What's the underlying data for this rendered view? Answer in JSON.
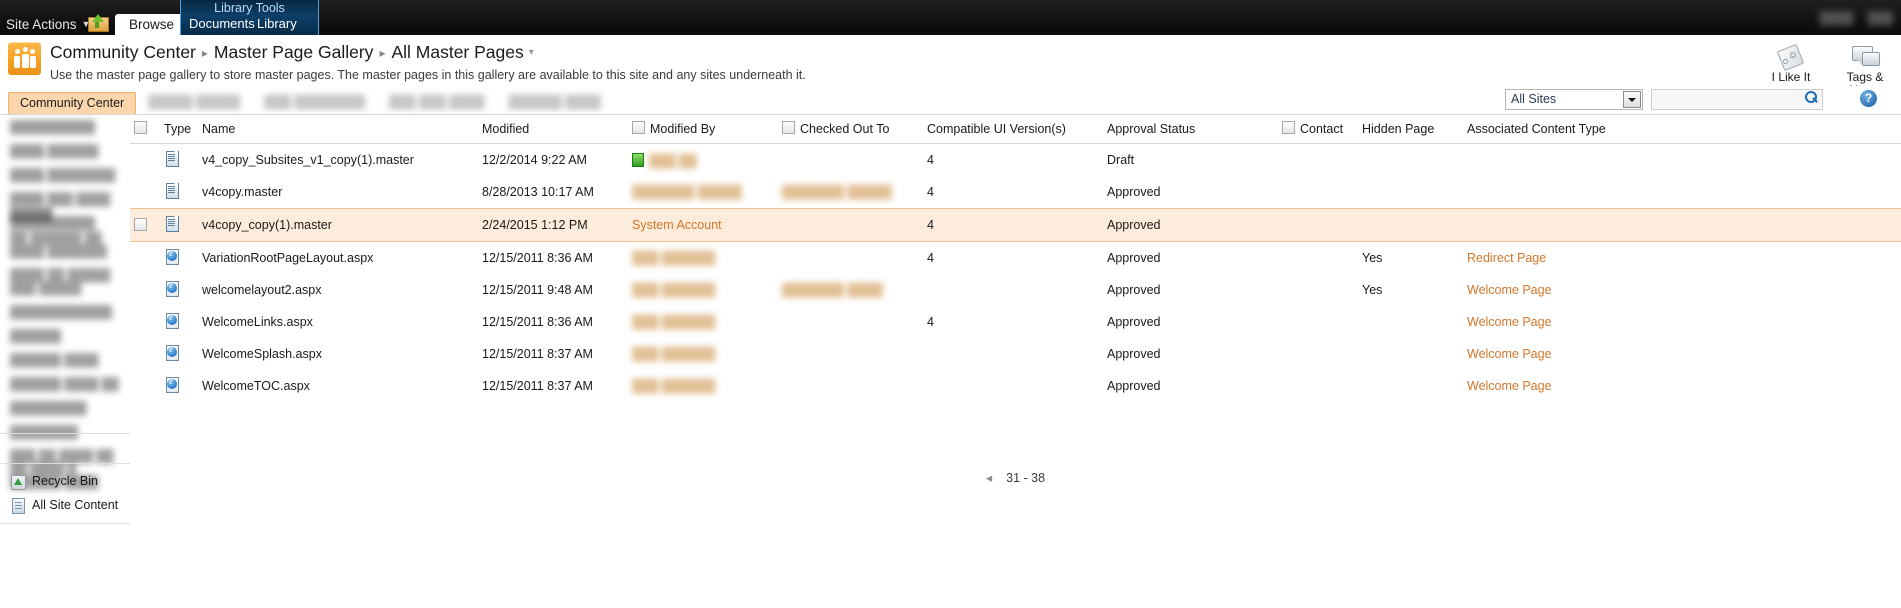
{
  "ribbon": {
    "site_actions": "Site Actions",
    "site_actions_caret": "▼",
    "navigate_up_icon": "navigate-up-icon",
    "browse_tab": "Browse",
    "contextual_group_title": "Library Tools",
    "contextual_tabs": [
      "Documents",
      "Library"
    ],
    "right_items": [
      "████",
      "███"
    ]
  },
  "header": {
    "breadcrumb": [
      {
        "label": "Community Center"
      },
      {
        "label": "Master Page Gallery"
      },
      {
        "label": "All Master Pages"
      }
    ],
    "breadcrumb_separator": "▸",
    "breadcrumb_caret": "▾",
    "description": "Use the master page gallery to store master pages. The master pages in this gallery are available to this site and any sites underneath it.",
    "social": [
      {
        "label": "I Like It",
        "icon": "tag-smiley-icon"
      },
      {
        "label": "Tags & Notes",
        "icon": "tags-notes-icon"
      }
    ]
  },
  "topnav": {
    "tabs": [
      {
        "label": "Community Center",
        "selected": true,
        "redacted": false
      },
      {
        "label": "█████ █████",
        "selected": false,
        "redacted": true
      },
      {
        "label": "███ ████████",
        "selected": false,
        "redacted": true
      },
      {
        "label": "███ ███ ████",
        "selected": false,
        "redacted": true
      },
      {
        "label": "██████ ████",
        "selected": false,
        "redacted": true
      }
    ],
    "search_scope_value": "All Sites",
    "search_placeholder": "",
    "search_value": "",
    "search_button_icon": "search-icon",
    "help_icon": "?"
  },
  "sidebar": {
    "libraries": [
      {
        "label": "██████████",
        "redacted": true
      },
      {
        "label": "████ ██████",
        "redacted": true
      },
      {
        "label": "████ ████████",
        "redacted": true
      },
      {
        "label": "████ ███ ████",
        "redacted": true
      },
      {
        "label": "██████████",
        "redacted": true
      }
    ],
    "lists_heading": "█████",
    "lists": [
      {
        "label": "██ ██████ ██ ████ ███████",
        "redacted": true
      },
      {
        "label": "████ ██ █████ ███ █████",
        "redacted": true
      },
      {
        "label": "████████████",
        "redacted": true
      },
      {
        "label": "██████",
        "redacted": true
      },
      {
        "label": "██████ ████",
        "redacted": true
      },
      {
        "label": "██████ ████ ██",
        "redacted": true
      },
      {
        "label": "█████████",
        "redacted": true
      },
      {
        "label": "████████",
        "redacted": true
      },
      {
        "label": "███ ██ ████ ██ ██ ████ █ ██████ ████",
        "redacted": true
      }
    ],
    "footer": [
      {
        "label": "Recycle Bin",
        "icon": "recycle-bin-icon"
      },
      {
        "label": "All Site Content",
        "icon": "all-site-content-icon"
      }
    ]
  },
  "listview": {
    "columns": [
      {
        "key": "checkbox",
        "label": "",
        "has_checkbox": true
      },
      {
        "key": "type",
        "label": "Type"
      },
      {
        "key": "name",
        "label": "Name"
      },
      {
        "key": "modified",
        "label": "Modified"
      },
      {
        "key": "modified_by",
        "label": "Modified By",
        "has_checkbox": true
      },
      {
        "key": "checked_out_to",
        "label": "Checked Out To",
        "has_checkbox": true
      },
      {
        "key": "compatible_ui",
        "label": "Compatible UI Version(s)"
      },
      {
        "key": "approval_status",
        "label": "Approval Status"
      },
      {
        "key": "contact",
        "label": "Contact",
        "has_checkbox": true
      },
      {
        "key": "hidden_page",
        "label": "Hidden Page"
      },
      {
        "key": "associated_content_type",
        "label": "Associated Content Type"
      }
    ],
    "rows": [
      {
        "icon": "master-page-icon",
        "name": "v4_copy_Subsites_v1_copy(1).master",
        "modified": "12/2/2014 9:22 AM",
        "modified_by": "███ ██",
        "modified_by_redacted": true,
        "status_flag": true,
        "checked_out_to": "",
        "checked_out_to_redacted": false,
        "compatible_ui": "4",
        "approval_status": "Draft",
        "contact": "",
        "hidden_page": "",
        "associated_content_type": "",
        "selected": false
      },
      {
        "icon": "master-page-icon",
        "name": "v4copy.master",
        "modified": "8/28/2013 10:17 AM",
        "modified_by": "███████ █████",
        "modified_by_redacted": true,
        "status_flag": false,
        "checked_out_to": "███████ █████",
        "checked_out_to_redacted": true,
        "compatible_ui": "4",
        "approval_status": "Approved",
        "contact": "",
        "hidden_page": "",
        "associated_content_type": "",
        "selected": false
      },
      {
        "icon": "master-page-icon",
        "name": "v4copy_copy(1).master",
        "modified": "2/24/2015 1:12 PM",
        "modified_by": "System Account",
        "modified_by_redacted": false,
        "status_flag": false,
        "checked_out_to": "",
        "checked_out_to_redacted": false,
        "compatible_ui": "4",
        "approval_status": "Approved",
        "contact": "",
        "hidden_page": "",
        "associated_content_type": "",
        "selected": true
      },
      {
        "icon": "aspx-page-icon",
        "name": "VariationRootPageLayout.aspx",
        "modified": "12/15/2011 8:36 AM",
        "modified_by": "███ ██████",
        "modified_by_redacted": true,
        "status_flag": false,
        "checked_out_to": "",
        "checked_out_to_redacted": false,
        "compatible_ui": "4",
        "approval_status": "Approved",
        "contact": "",
        "hidden_page": "Yes",
        "associated_content_type": "Redirect Page",
        "selected": false
      },
      {
        "icon": "aspx-page-icon",
        "name": "welcomelayout2.aspx",
        "modified": "12/15/2011 9:48 AM",
        "modified_by": "███ ██████",
        "modified_by_redacted": true,
        "status_flag": false,
        "checked_out_to": "███████ ████",
        "checked_out_to_redacted": true,
        "compatible_ui": "",
        "approval_status": "Approved",
        "contact": "",
        "hidden_page": "Yes",
        "associated_content_type": "Welcome Page",
        "selected": false
      },
      {
        "icon": "aspx-page-icon",
        "name": "WelcomeLinks.aspx",
        "modified": "12/15/2011 8:36 AM",
        "modified_by": "███ ██████",
        "modified_by_redacted": true,
        "status_flag": false,
        "checked_out_to": "",
        "checked_out_to_redacted": false,
        "compatible_ui": "4",
        "approval_status": "Approved",
        "contact": "",
        "hidden_page": "",
        "associated_content_type": "Welcome Page",
        "selected": false
      },
      {
        "icon": "aspx-page-icon",
        "name": "WelcomeSplash.aspx",
        "modified": "12/15/2011 8:37 AM",
        "modified_by": "███ ██████",
        "modified_by_redacted": true,
        "status_flag": false,
        "checked_out_to": "",
        "checked_out_to_redacted": false,
        "compatible_ui": "",
        "approval_status": "Approved",
        "contact": "",
        "hidden_page": "",
        "associated_content_type": "Welcome Page",
        "selected": false
      },
      {
        "icon": "aspx-page-icon",
        "name": "WelcomeTOC.aspx",
        "modified": "12/15/2011 8:37 AM",
        "modified_by": "███ ██████",
        "modified_by_redacted": true,
        "status_flag": false,
        "checked_out_to": "",
        "checked_out_to_redacted": false,
        "compatible_ui": "",
        "approval_status": "Approved",
        "contact": "",
        "hidden_page": "",
        "associated_content_type": "Welcome Page",
        "selected": false
      }
    ],
    "pager": {
      "prev_icon": "◂",
      "range": "31 - 38"
    }
  },
  "colors": {
    "accent_orange": "#d4762a",
    "selected_row": "#fdecdb",
    "selected_tab": "#fbd6ad",
    "ribbon_black": "#151515",
    "contextual_blue": "#0d3f68"
  }
}
